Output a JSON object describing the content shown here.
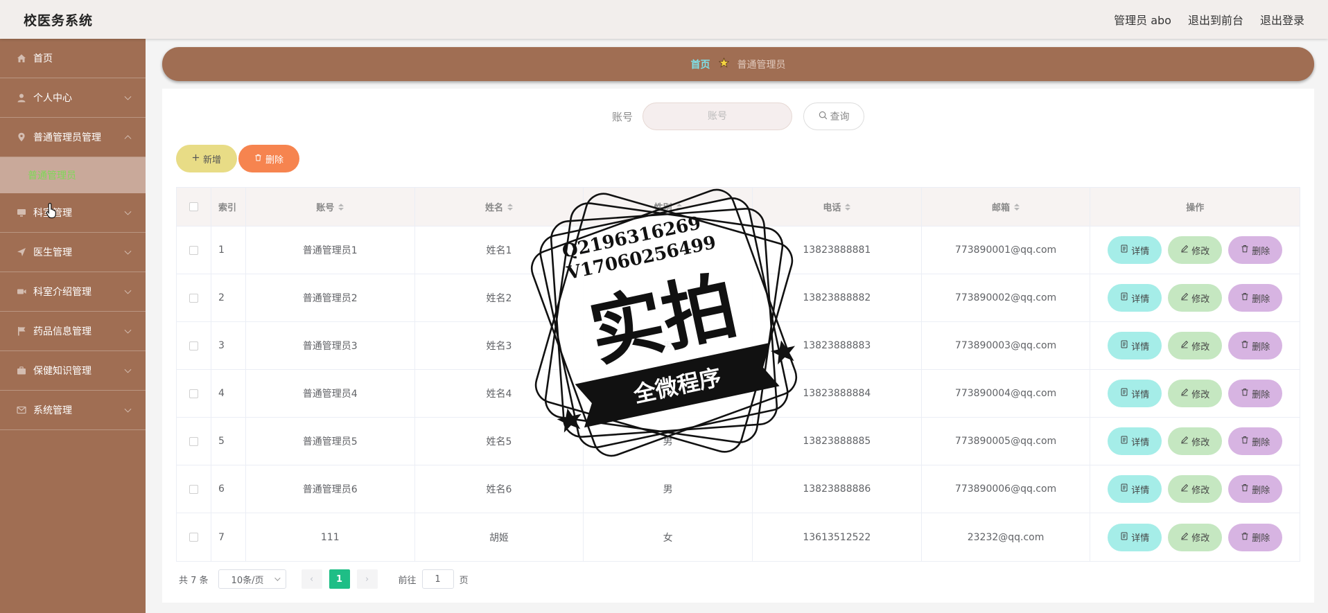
{
  "app": {
    "title": "校医务系统"
  },
  "header": {
    "user_label": "管理员 abo",
    "front_label": "退出到前台",
    "logout_label": "退出登录"
  },
  "sidebar": {
    "items": [
      {
        "label": "首页",
        "icon": "home-icon"
      },
      {
        "label": "个人中心",
        "icon": "user-icon"
      },
      {
        "label": "普通管理员管理",
        "icon": "pin-icon",
        "expanded": true,
        "children": [
          {
            "label": "普通管理员"
          }
        ]
      },
      {
        "label": "科室管理",
        "icon": "monitor-icon"
      },
      {
        "label": "医生管理",
        "icon": "send-icon"
      },
      {
        "label": "科室介绍管理",
        "icon": "video-icon"
      },
      {
        "label": "药品信息管理",
        "icon": "flag-icon"
      },
      {
        "label": "保健知识管理",
        "icon": "briefcase-icon"
      },
      {
        "label": "系统管理",
        "icon": "mail-icon"
      }
    ]
  },
  "breadcrumb": {
    "home": "首页",
    "current": "普通管理员",
    "separator_icon": "star-icon"
  },
  "search": {
    "label": "账号",
    "placeholder": "账号",
    "value": "",
    "button_label": "查询"
  },
  "actions": {
    "add_label": "新增",
    "delete_label": "删除"
  },
  "table": {
    "headers": {
      "index": "索引",
      "account": "账号",
      "name": "姓名",
      "gender": "性别",
      "phone": "电话",
      "email": "邮箱",
      "actions": "操作"
    },
    "row_actions": {
      "detail": "详情",
      "edit": "修改",
      "delete": "删除"
    },
    "rows": [
      {
        "index": "1",
        "account": "普通管理员1",
        "name": "姓名1",
        "gender": "男",
        "phone": "13823888881",
        "email": "773890001@qq.com"
      },
      {
        "index": "2",
        "account": "普通管理员2",
        "name": "姓名2",
        "gender": "男",
        "phone": "13823888882",
        "email": "773890002@qq.com"
      },
      {
        "index": "3",
        "account": "普通管理员3",
        "name": "姓名3",
        "gender": "男",
        "phone": "13823888883",
        "email": "773890003@qq.com"
      },
      {
        "index": "4",
        "account": "普通管理员4",
        "name": "姓名4",
        "gender": "男",
        "phone": "13823888884",
        "email": "773890004@qq.com"
      },
      {
        "index": "5",
        "account": "普通管理员5",
        "name": "姓名5",
        "gender": "男",
        "phone": "13823888885",
        "email": "773890005@qq.com"
      },
      {
        "index": "6",
        "account": "普通管理员6",
        "name": "姓名6",
        "gender": "男",
        "phone": "13823888886",
        "email": "773890006@qq.com"
      },
      {
        "index": "7",
        "account": "111",
        "name": "胡姬",
        "gender": "女",
        "phone": "13613512522",
        "email": "23232@qq.com"
      }
    ]
  },
  "pagination": {
    "total_label": "共 7 条",
    "page_size": "10条/页",
    "current_page": "1",
    "goto_prefix": "前往",
    "goto_value": "1",
    "goto_suffix": "页"
  },
  "watermark": {
    "line1": "Q2196316269",
    "line2": "V17060256499",
    "main": "实拍",
    "banner": "全微程序"
  },
  "colors": {
    "sidebar": "#a06e53",
    "header": "#f2eeec",
    "active_submenu_text": "#7ed957",
    "add_button": "#e8dc86",
    "delete_button": "#f6844f",
    "detail_button": "#a5ede8",
    "edit_button": "#c5e7c1",
    "remove_button": "#d7b4e2",
    "page_active": "#1fbe86"
  }
}
